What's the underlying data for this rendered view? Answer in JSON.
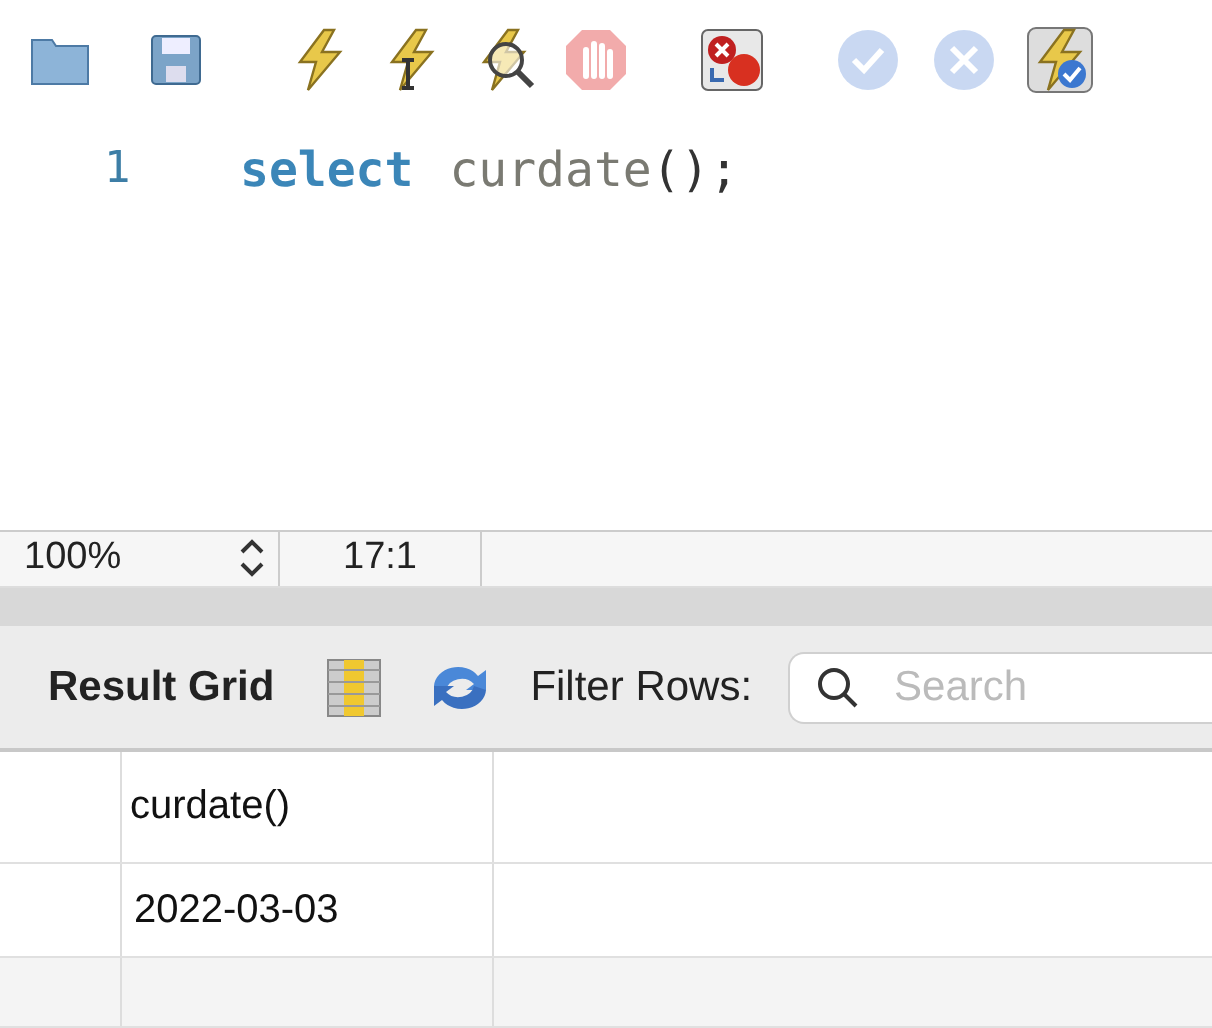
{
  "toolbar": [
    {
      "kind": "folder",
      "disabled": false
    },
    {
      "kind": "save",
      "disabled": false
    },
    {
      "kind": "execute",
      "disabled": false
    },
    {
      "kind": "execute-current",
      "disabled": false
    },
    {
      "kind": "explain",
      "disabled": false
    },
    {
      "kind": "stop",
      "disabled": true
    },
    {
      "kind": "stop-on-error",
      "disabled": false
    },
    {
      "kind": "commit",
      "disabled": true
    },
    {
      "kind": "rollback",
      "disabled": true
    },
    {
      "kind": "autocommit",
      "disabled": false
    }
  ],
  "editor": {
    "lines": [
      {
        "number": "1",
        "tokens": [
          {
            "kind": "keyword",
            "text": "select"
          },
          {
            "kind": "function",
            "text": "curdate"
          },
          {
            "kind": "punct",
            "text": "();"
          }
        ]
      }
    ]
  },
  "status_bar": {
    "zoom": "100%",
    "position": "17:1"
  },
  "result": {
    "title": "Result Grid",
    "filter_label": "Filter Rows:",
    "search": {
      "placeholder": "Search"
    },
    "columns": [
      "curdate()"
    ],
    "rows": [
      [
        "2022-03-03"
      ],
      [
        ""
      ]
    ]
  }
}
